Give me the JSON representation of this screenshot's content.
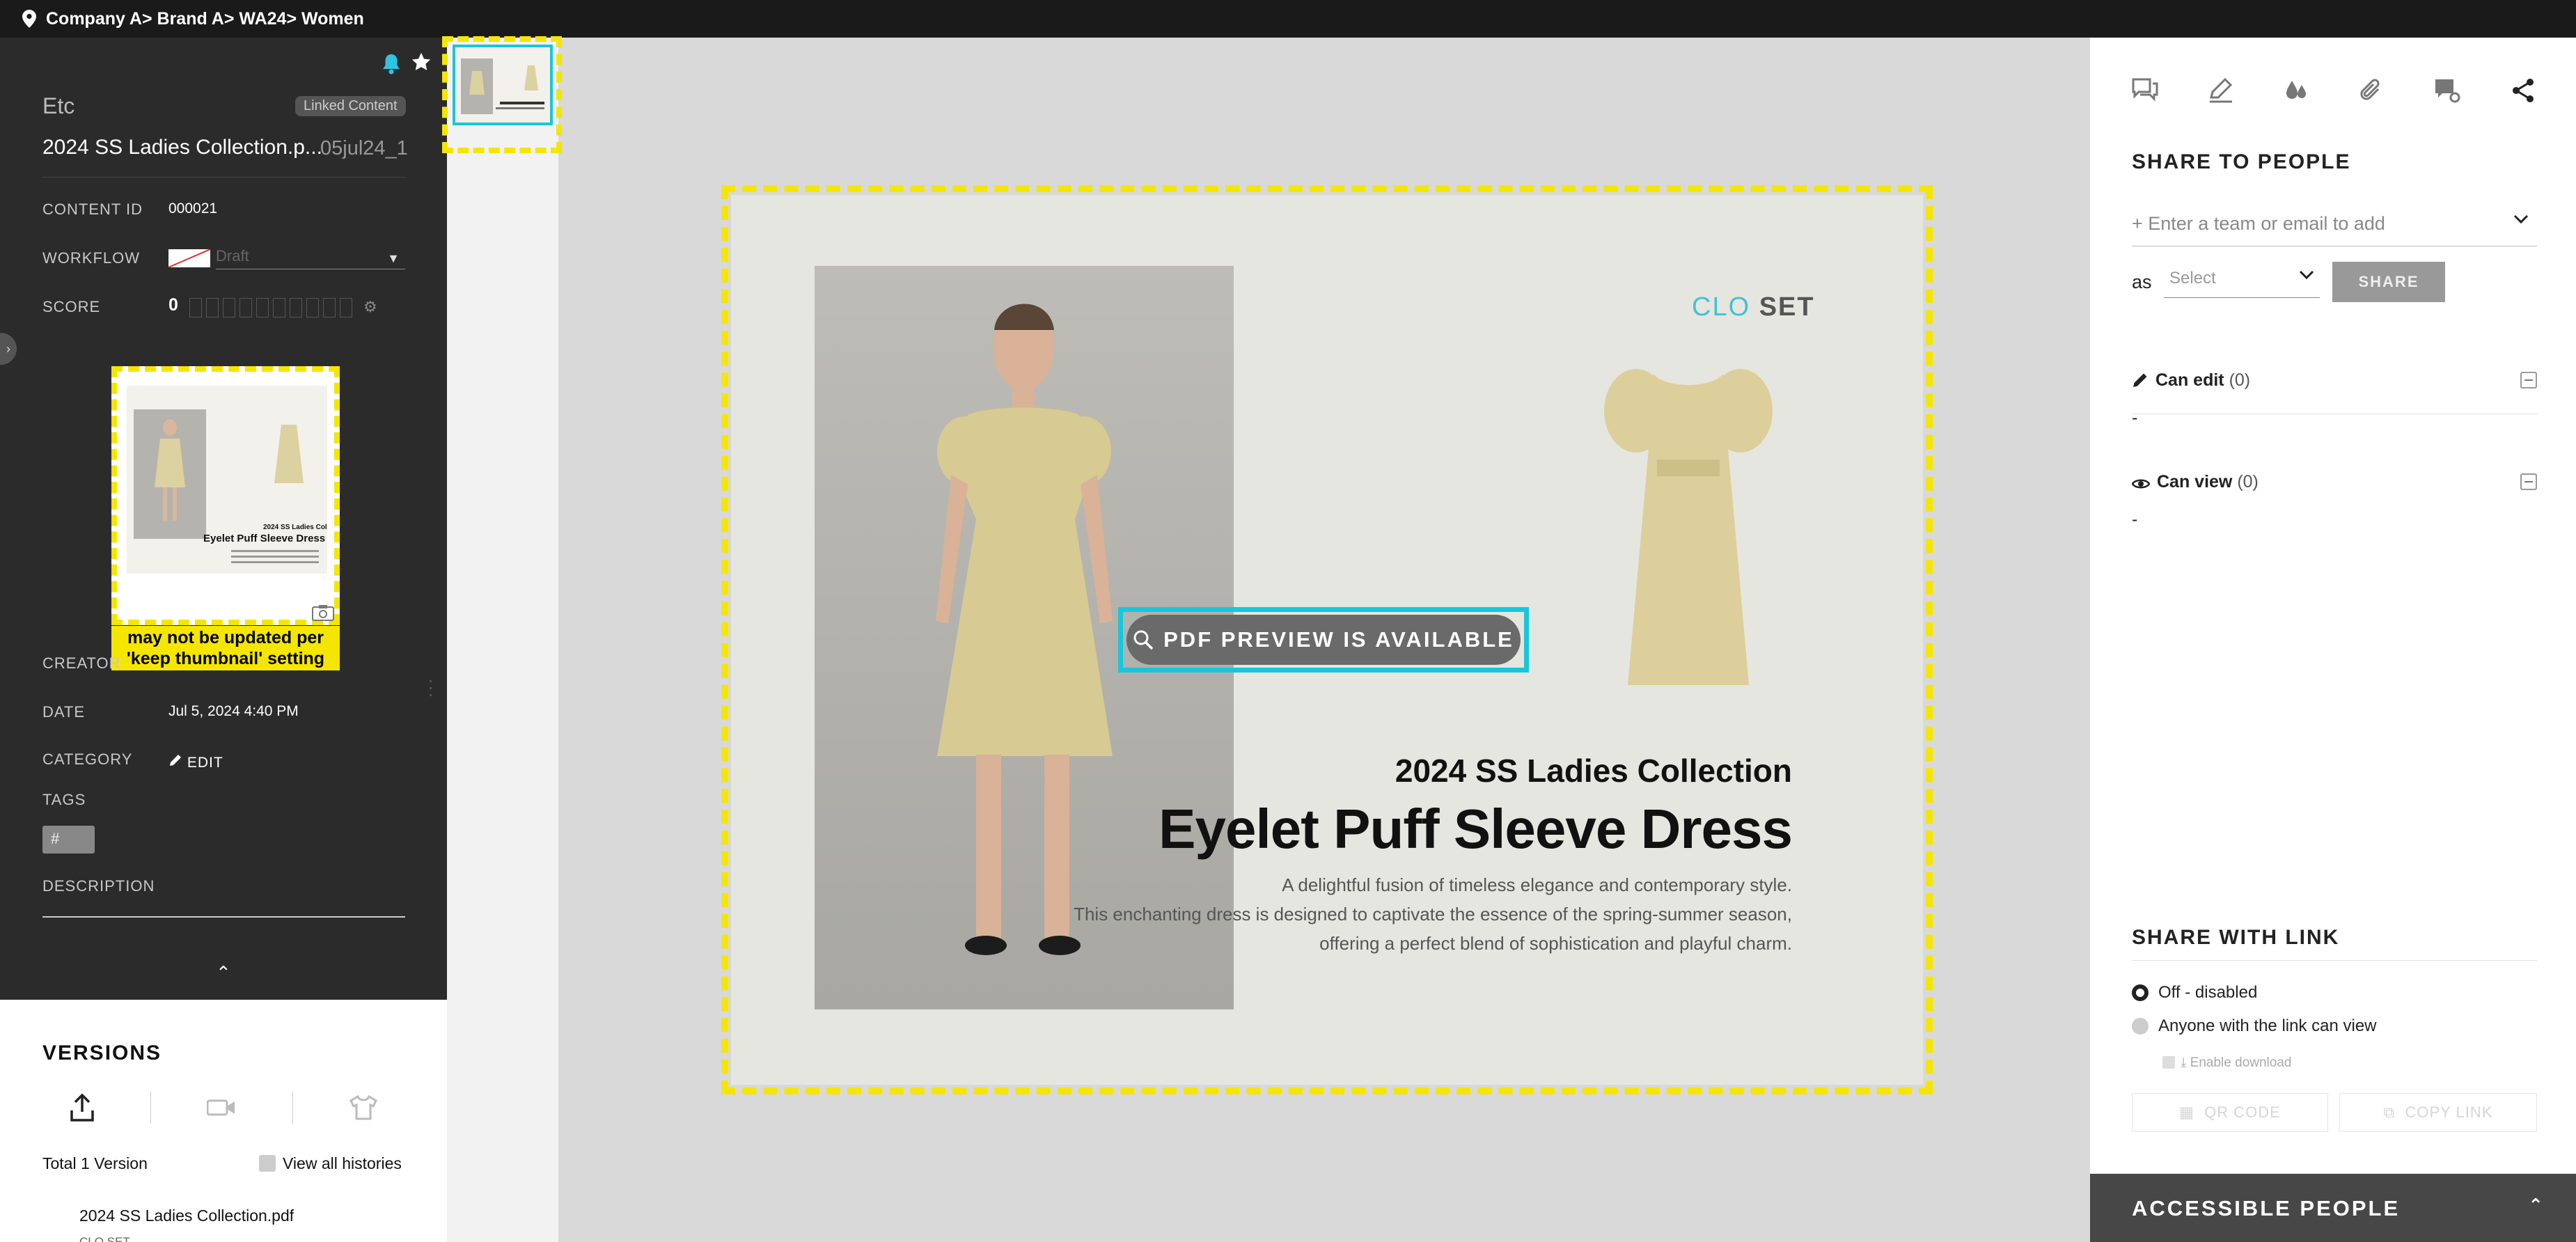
{
  "breadcrumb": "Company A> Brand A> WA24> Women",
  "left_panel": {
    "category_label": "Etc",
    "linked_badge": "Linked Content",
    "file_name": "2024 SS Ladies Collection.p...",
    "file_version": "05jul24_1",
    "content_id_label": "CONTENT ID",
    "content_id_value": "000021",
    "workflow_label": "WORKFLOW",
    "workflow_value": "Draft",
    "score_label": "SCORE",
    "score_value": "0",
    "thumbnail_note": "may not be updated per 'keep thumbnail' setting",
    "creator_label": "CREATOR",
    "date_label": "DATE",
    "date_value": "Jul 5, 2024 4:40 PM",
    "category_field_label": "CATEGORY",
    "edit_label": "EDIT",
    "tags_label": "TAGS",
    "tag_placeholder": "#",
    "description_label": "DESCRIPTION"
  },
  "versions": {
    "title": "VERSIONS",
    "total": "Total 1 Version",
    "view_all": "View all histories",
    "file": "2024 SS Ladies Collection.pdf",
    "file_sub": "CLO SET"
  },
  "preview": {
    "brand_a": "CLO",
    "brand_b": "SET",
    "collection": "2024 SS Ladies Collection",
    "product": "Eyelet Puff Sleeve Dress",
    "desc_lines": [
      "A delightful fusion of timeless elegance and contemporary style.",
      "This enchanting dress is designed to captivate the essence of the spring-summer season,",
      "offering a perfect blend of sophistication and playful charm."
    ],
    "pdf_button": "PDF PREVIEW IS AVAILABLE"
  },
  "right_panel": {
    "share_title": "SHARE TO PEOPLE",
    "input_placeholder": "+ Enter a team or email to add",
    "as_label": "as",
    "as_select": "Select",
    "share_button": "SHARE",
    "can_edit": "Can edit",
    "can_edit_count": "(0)",
    "can_edit_empty": "-",
    "can_view": "Can view",
    "can_view_count": "(0)",
    "can_view_empty": "-",
    "link_title": "SHARE WITH LINK",
    "link_off": "Off - disabled",
    "link_anyone": "Anyone with the link can view",
    "enable_download": "Enable download",
    "qr_code": "QR CODE",
    "copy_link": "COPY LINK",
    "accessible": "ACCESSIBLE PEOPLE"
  },
  "colors": {
    "highlight_yellow": "#f5e600",
    "highlight_cyan": "#18c6dc",
    "brand_cyan": "#40c3d3",
    "dark_panel": "#2b2b2b"
  }
}
